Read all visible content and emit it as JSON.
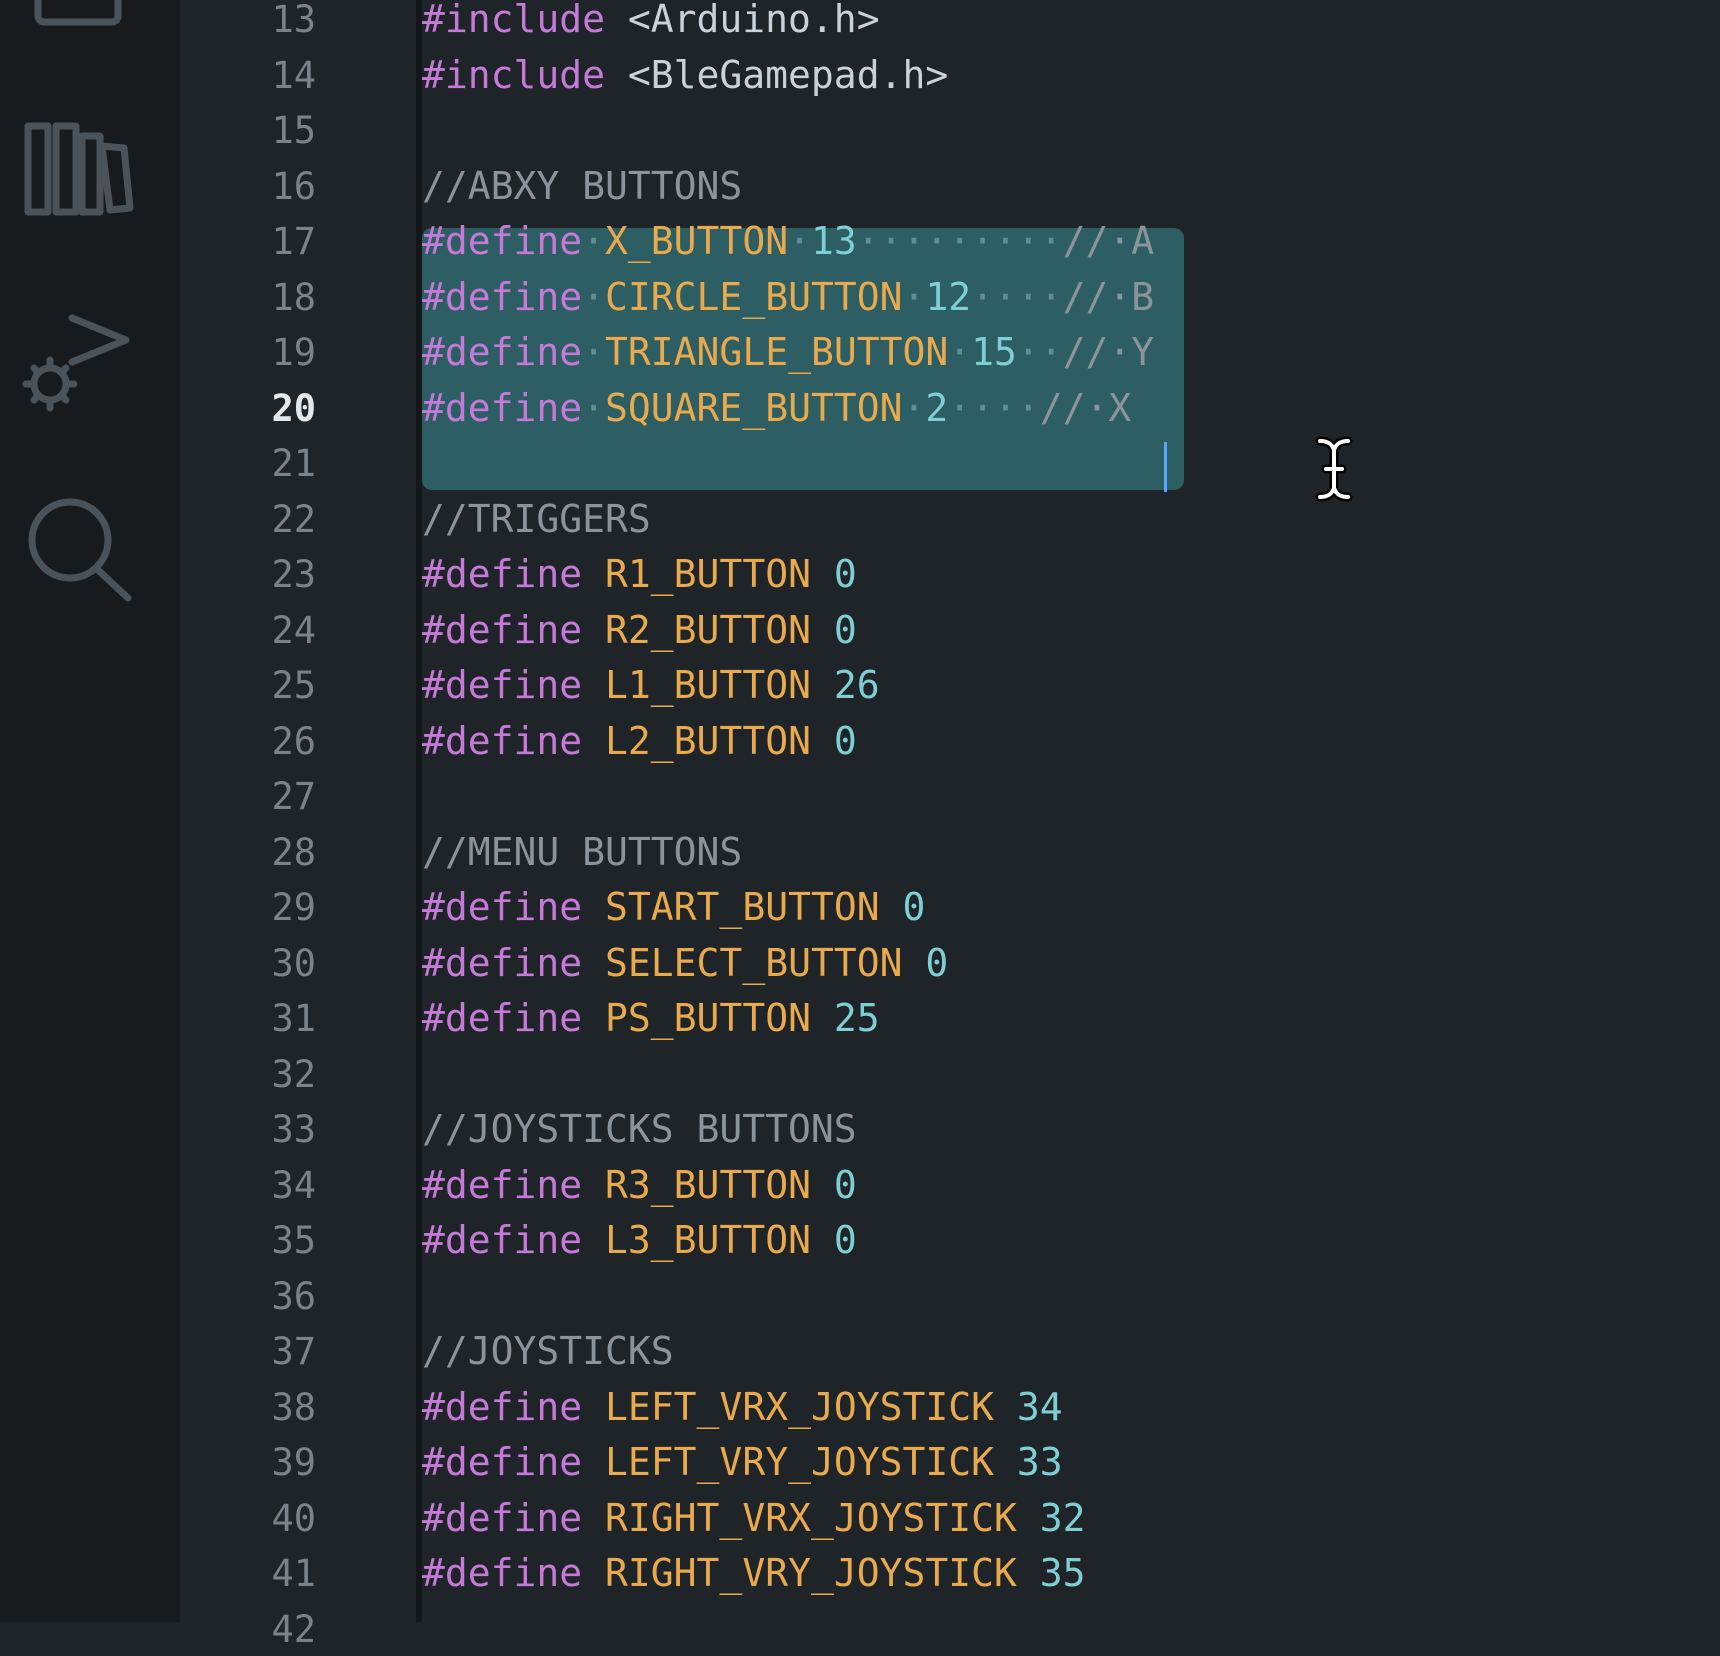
{
  "activity_bar": {
    "icons": [
      "explorer-icon",
      "library-icon",
      "debug-icon",
      "search-icon"
    ]
  },
  "gutter": {
    "line_numbers": [
      "13",
      "14",
      "15",
      "16",
      "17",
      "18",
      "19",
      "20",
      "21",
      "22",
      "23",
      "24",
      "25",
      "26",
      "27",
      "28",
      "29",
      "30",
      "31",
      "32",
      "33",
      "34",
      "35",
      "36",
      "37",
      "38",
      "39",
      "40",
      "41",
      "42"
    ],
    "active_line": "20"
  },
  "editor": {
    "lines": [
      {
        "no": 13,
        "tokens": [
          {
            "t": "#include",
            "c": "kw"
          },
          {
            "t": " <Arduino.h>",
            "c": "txt"
          }
        ]
      },
      {
        "no": 14,
        "tokens": [
          {
            "t": "#include",
            "c": "kw"
          },
          {
            "t": " <BleGamepad.h>",
            "c": "txt"
          }
        ]
      },
      {
        "no": 15,
        "tokens": []
      },
      {
        "no": 16,
        "tokens": [
          {
            "t": "//ABXY BUTTONS",
            "c": "cm"
          }
        ]
      },
      {
        "no": 17,
        "tokens": [
          {
            "t": "#define",
            "c": "kw"
          },
          {
            "t": "·",
            "c": "ws"
          },
          {
            "t": "X_BUTTON",
            "c": "mac"
          },
          {
            "t": "·",
            "c": "ws"
          },
          {
            "t": "13",
            "c": "num"
          },
          {
            "t": "·········",
            "c": "ws"
          },
          {
            "t": "//·A",
            "c": "cm"
          }
        ]
      },
      {
        "no": 18,
        "tokens": [
          {
            "t": "#define",
            "c": "kw"
          },
          {
            "t": "·",
            "c": "ws"
          },
          {
            "t": "CIRCLE_BUTTON",
            "c": "mac"
          },
          {
            "t": "·",
            "c": "ws"
          },
          {
            "t": "12",
            "c": "num"
          },
          {
            "t": "····",
            "c": "ws"
          },
          {
            "t": "//·B",
            "c": "cm"
          }
        ]
      },
      {
        "no": 19,
        "tokens": [
          {
            "t": "#define",
            "c": "kw"
          },
          {
            "t": "·",
            "c": "ws"
          },
          {
            "t": "TRIANGLE_BUTTON",
            "c": "mac"
          },
          {
            "t": "·",
            "c": "ws"
          },
          {
            "t": "15",
            "c": "num"
          },
          {
            "t": "··",
            "c": "ws"
          },
          {
            "t": "//·Y",
            "c": "cm"
          }
        ]
      },
      {
        "no": 20,
        "tokens": [
          {
            "t": "#define",
            "c": "kw"
          },
          {
            "t": "·",
            "c": "ws"
          },
          {
            "t": "SQUARE_BUTTON",
            "c": "mac"
          },
          {
            "t": "·",
            "c": "ws"
          },
          {
            "t": "2",
            "c": "num"
          },
          {
            "t": "····",
            "c": "ws"
          },
          {
            "t": "//·X",
            "c": "cm"
          }
        ]
      },
      {
        "no": 21,
        "tokens": []
      },
      {
        "no": 22,
        "tokens": [
          {
            "t": "//TRIGGERS",
            "c": "cm"
          }
        ]
      },
      {
        "no": 23,
        "tokens": [
          {
            "t": "#define",
            "c": "kw"
          },
          {
            "t": " ",
            "c": "txt"
          },
          {
            "t": "R1_BUTTON",
            "c": "mac"
          },
          {
            "t": " ",
            "c": "txt"
          },
          {
            "t": "0",
            "c": "num"
          }
        ]
      },
      {
        "no": 24,
        "tokens": [
          {
            "t": "#define",
            "c": "kw"
          },
          {
            "t": " ",
            "c": "txt"
          },
          {
            "t": "R2_BUTTON",
            "c": "mac"
          },
          {
            "t": " ",
            "c": "txt"
          },
          {
            "t": "0",
            "c": "num"
          }
        ]
      },
      {
        "no": 25,
        "tokens": [
          {
            "t": "#define",
            "c": "kw"
          },
          {
            "t": " ",
            "c": "txt"
          },
          {
            "t": "L1_BUTTON",
            "c": "mac"
          },
          {
            "t": " ",
            "c": "txt"
          },
          {
            "t": "26",
            "c": "num"
          }
        ]
      },
      {
        "no": 26,
        "tokens": [
          {
            "t": "#define",
            "c": "kw"
          },
          {
            "t": " ",
            "c": "txt"
          },
          {
            "t": "L2_BUTTON",
            "c": "mac"
          },
          {
            "t": " ",
            "c": "txt"
          },
          {
            "t": "0",
            "c": "num"
          }
        ]
      },
      {
        "no": 27,
        "tokens": []
      },
      {
        "no": 28,
        "tokens": [
          {
            "t": "//MENU BUTTONS",
            "c": "cm"
          }
        ]
      },
      {
        "no": 29,
        "tokens": [
          {
            "t": "#define",
            "c": "kw"
          },
          {
            "t": " ",
            "c": "txt"
          },
          {
            "t": "START_BUTTON",
            "c": "mac"
          },
          {
            "t": " ",
            "c": "txt"
          },
          {
            "t": "0",
            "c": "num"
          }
        ]
      },
      {
        "no": 30,
        "tokens": [
          {
            "t": "#define",
            "c": "kw"
          },
          {
            "t": " ",
            "c": "txt"
          },
          {
            "t": "SELECT_BUTTON",
            "c": "mac"
          },
          {
            "t": " ",
            "c": "txt"
          },
          {
            "t": "0",
            "c": "num"
          }
        ]
      },
      {
        "no": 31,
        "tokens": [
          {
            "t": "#define",
            "c": "kw"
          },
          {
            "t": " ",
            "c": "txt"
          },
          {
            "t": "PS_BUTTON",
            "c": "mac"
          },
          {
            "t": " ",
            "c": "txt"
          },
          {
            "t": "25",
            "c": "num"
          }
        ]
      },
      {
        "no": 32,
        "tokens": []
      },
      {
        "no": 33,
        "tokens": [
          {
            "t": "//JOYSTICKS BUTTONS",
            "c": "cm"
          }
        ]
      },
      {
        "no": 34,
        "tokens": [
          {
            "t": "#define",
            "c": "kw"
          },
          {
            "t": " ",
            "c": "txt"
          },
          {
            "t": "R3_BUTTON",
            "c": "mac"
          },
          {
            "t": " ",
            "c": "txt"
          },
          {
            "t": "0",
            "c": "num"
          }
        ]
      },
      {
        "no": 35,
        "tokens": [
          {
            "t": "#define",
            "c": "kw"
          },
          {
            "t": " ",
            "c": "txt"
          },
          {
            "t": "L3_BUTTON",
            "c": "mac"
          },
          {
            "t": " ",
            "c": "txt"
          },
          {
            "t": "0",
            "c": "num"
          }
        ]
      },
      {
        "no": 36,
        "tokens": []
      },
      {
        "no": 37,
        "tokens": [
          {
            "t": "//JOYSTICKS",
            "c": "cm"
          }
        ]
      },
      {
        "no": 38,
        "tokens": [
          {
            "t": "#define",
            "c": "kw"
          },
          {
            "t": " ",
            "c": "txt"
          },
          {
            "t": "LEFT_VRX_JOYSTICK",
            "c": "mac"
          },
          {
            "t": " ",
            "c": "txt"
          },
          {
            "t": "34",
            "c": "num"
          }
        ]
      },
      {
        "no": 39,
        "tokens": [
          {
            "t": "#define",
            "c": "kw"
          },
          {
            "t": " ",
            "c": "txt"
          },
          {
            "t": "LEFT_VRY_JOYSTICK",
            "c": "mac"
          },
          {
            "t": " ",
            "c": "txt"
          },
          {
            "t": "33",
            "c": "num"
          }
        ]
      },
      {
        "no": 40,
        "tokens": [
          {
            "t": "#define",
            "c": "kw"
          },
          {
            "t": " ",
            "c": "txt"
          },
          {
            "t": "RIGHT_VRX_JOYSTICK",
            "c": "mac"
          },
          {
            "t": " ",
            "c": "txt"
          },
          {
            "t": "32",
            "c": "num"
          }
        ]
      },
      {
        "no": 41,
        "tokens": [
          {
            "t": "#define",
            "c": "kw"
          },
          {
            "t": " ",
            "c": "txt"
          },
          {
            "t": "RIGHT_VRY_JOYSTICK",
            "c": "mac"
          },
          {
            "t": " ",
            "c": "txt"
          },
          {
            "t": "35",
            "c": "num"
          }
        ]
      },
      {
        "no": 42,
        "tokens": []
      }
    ],
    "selected_lines": [
      17,
      18,
      19,
      20
    ],
    "cursor_line": 20
  },
  "colors": {
    "background": "#1f2428",
    "activity_bar": "#171b1e",
    "selection": "#2c5e63",
    "keyword": "#c57ad8",
    "macro": "#e9a94d",
    "number": "#7ecfd4",
    "comment": "#8b939b",
    "caret": "#5aa6ff"
  }
}
